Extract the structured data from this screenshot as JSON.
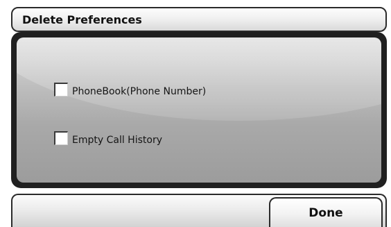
{
  "header": {
    "title": "Delete Preferences"
  },
  "options": [
    {
      "label": "PhoneBook(Phone Number)",
      "checked": false
    },
    {
      "label": "Empty Call History",
      "checked": false
    }
  ],
  "footer": {
    "done_label": "Done"
  }
}
